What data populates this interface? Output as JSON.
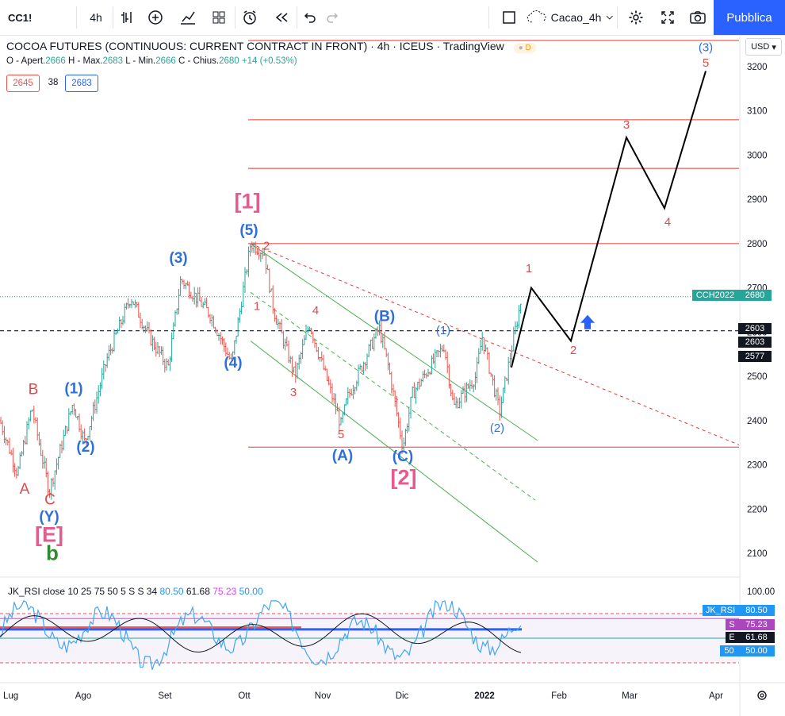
{
  "toolbar": {
    "symbol": "CC1!",
    "interval": "4h",
    "layout_name": "Cacao_4h",
    "publish_label": "Pubblica"
  },
  "legend": {
    "title": "COCOA FUTURES (CONTINUOUS: CURRENT CONTRACT IN FRONT)",
    "interval": "4h",
    "exchange": "ICEUS",
    "source": "TradingView",
    "delay_badge": "D",
    "ohlc": {
      "open_label": "O - Apert.",
      "open": "2666",
      "high_label": "H - Max.",
      "high": "2683",
      "low_label": "L - Min.",
      "low": "2666",
      "close_label": "C - Chius.",
      "close": "2680",
      "change": "+14 (+0.53%)"
    },
    "badges": {
      "bid": "2645",
      "spread": "38",
      "ask": "2683"
    }
  },
  "currency": "USD",
  "colors": {
    "up": "#26a69a",
    "down": "#ef5350",
    "accent": "#2962ff",
    "wave_blue": "#2f6fdc",
    "wave_red": "#e24a4a",
    "wave_pink": "#e65a8f",
    "wave_green": "#2e8b2e",
    "rsi_line": "#7e57c2"
  },
  "chart_data": {
    "type": "line",
    "title": "COCOA FUTURES (CONTINUOUS: CURRENT CONTRACT IN FRONT)",
    "xlabel": "",
    "ylabel": "",
    "x_ticks": [
      "Lug",
      "Ago",
      "Set",
      "Ott",
      "Nov",
      "Dic",
      "2022",
      "Feb",
      "Mar",
      "Apr"
    ],
    "y_ticks": [
      2100,
      2200,
      2300,
      2400,
      2500,
      2600,
      2700,
      2800,
      2900,
      3000,
      3100,
      3200
    ],
    "ylim": [
      2030,
      3270
    ],
    "price_path": [
      {
        "x": 0,
        "y": 2400
      },
      {
        "x": 22,
        "y": 2280
      },
      {
        "x": 40,
        "y": 2430
      },
      {
        "x": 62,
        "y": 2240
      },
      {
        "x": 92,
        "y": 2440
      },
      {
        "x": 107,
        "y": 2350
      },
      {
        "x": 135,
        "y": 2540
      },
      {
        "x": 165,
        "y": 2680
      },
      {
        "x": 188,
        "y": 2590
      },
      {
        "x": 212,
        "y": 2520
      },
      {
        "x": 228,
        "y": 2720
      },
      {
        "x": 265,
        "y": 2640
      },
      {
        "x": 292,
        "y": 2530
      },
      {
        "x": 316,
        "y": 2800
      },
      {
        "x": 333,
        "y": 2780
      },
      {
        "x": 345,
        "y": 2650
      },
      {
        "x": 372,
        "y": 2500
      },
      {
        "x": 390,
        "y": 2620
      },
      {
        "x": 430,
        "y": 2390
      },
      {
        "x": 438,
        "y": 2450
      },
      {
        "x": 478,
        "y": 2610
      },
      {
        "x": 490,
        "y": 2520
      },
      {
        "x": 508,
        "y": 2340
      },
      {
        "x": 520,
        "y": 2460
      },
      {
        "x": 560,
        "y": 2570
      },
      {
        "x": 572,
        "y": 2430
      },
      {
        "x": 600,
        "y": 2500
      },
      {
        "x": 608,
        "y": 2590
      },
      {
        "x": 630,
        "y": 2420
      },
      {
        "x": 658,
        "y": 2680
      }
    ],
    "projection": [
      {
        "x": 645,
        "y": 2520
      },
      {
        "x": 670,
        "y": 2700
      },
      {
        "x": 720,
        "y": 2580
      },
      {
        "x": 790,
        "y": 3040
      },
      {
        "x": 838,
        "y": 2880
      },
      {
        "x": 890,
        "y": 3190
      }
    ],
    "horizontal_levels": [
      3330,
      3080,
      2970,
      2800,
      2340
    ],
    "dashed_level": 2603,
    "price_labels": [
      {
        "label": "CCH2022",
        "value": "2680",
        "color": "#26a69a"
      },
      {
        "label": "",
        "value": "2603",
        "color": "#131722"
      },
      {
        "label": "",
        "value": "2603",
        "color": "#131722"
      },
      {
        "label": "",
        "value": "2577",
        "color": "#131722"
      }
    ],
    "wave_labels": [
      {
        "text": "B",
        "color": "red",
        "x": 42,
        "y": 2460
      },
      {
        "text": "(1)",
        "color": "blue",
        "x": 93,
        "y": 2462
      },
      {
        "text": "(2)",
        "color": "blue",
        "x": 108,
        "y": 2330
      },
      {
        "text": "A",
        "color": "red",
        "x": 31,
        "y": 2235
      },
      {
        "text": "C",
        "color": "red",
        "x": 63,
        "y": 2210
      },
      {
        "text": "(Y)",
        "color": "blue",
        "x": 62,
        "y": 2172
      },
      {
        "text": "[E]",
        "color": "pink",
        "x": 62,
        "y": 2126
      },
      {
        "text": "b",
        "color": "green",
        "x": 66,
        "y": 2085
      },
      {
        "text": "(3)",
        "color": "blue",
        "x": 225,
        "y": 2757
      },
      {
        "text": "(4)",
        "color": "blue",
        "x": 294,
        "y": 2520
      },
      {
        "text": "[1]",
        "color": "pink",
        "x": 312,
        "y": 2880
      },
      {
        "text": "(5)",
        "color": "blue",
        "x": 314,
        "y": 2820
      },
      {
        "text": "2",
        "color": "red",
        "x": 336,
        "y": 2786
      },
      {
        "text": "1",
        "color": "red",
        "x": 324,
        "y": 2650
      },
      {
        "text": "4",
        "color": "red",
        "x": 398,
        "y": 2640
      },
      {
        "text": "3",
        "color": "red",
        "x": 370,
        "y": 2455
      },
      {
        "text": "5",
        "color": "red",
        "x": 430,
        "y": 2360
      },
      {
        "text": "(A)",
        "color": "blue",
        "x": 432,
        "y": 2310
      },
      {
        "text": "(B)",
        "color": "blue",
        "x": 485,
        "y": 2625
      },
      {
        "text": "(C)",
        "color": "blue",
        "x": 508,
        "y": 2308
      },
      {
        "text": "[2]",
        "color": "pink",
        "x": 509,
        "y": 2255
      },
      {
        "text": "(1)",
        "color": "blue",
        "x": 559,
        "y": 2595
      },
      {
        "text": "(2)",
        "color": "blue",
        "x": 627,
        "y": 2375
      },
      {
        "text": "1",
        "color": "red",
        "x": 667,
        "y": 2735
      },
      {
        "text": "2",
        "color": "red",
        "x": 723,
        "y": 2550
      },
      {
        "text": "3",
        "color": "red",
        "x": 790,
        "y": 3060
      },
      {
        "text": "4",
        "color": "red",
        "x": 842,
        "y": 2840
      },
      {
        "text": "(3)",
        "color": "blue",
        "x": 890,
        "y": 3235
      },
      {
        "text": "5",
        "color": "red",
        "x": 890,
        "y": 3200
      }
    ],
    "grid": false
  },
  "rsi": {
    "name": "JK_RSI",
    "params": "close 10 25 75 50 5 S S 34",
    "values": [
      "80.50",
      "61.68",
      "75.23",
      "50.00"
    ],
    "y_ticks": [
      "100.00"
    ],
    "labels": [
      {
        "tag": "JK_RSI",
        "value": "80.50"
      },
      {
        "tag": "S",
        "value": "75.23"
      },
      {
        "tag": "E",
        "value": "61.68"
      },
      {
        "tag": "50",
        "value": "50.00"
      }
    ]
  }
}
